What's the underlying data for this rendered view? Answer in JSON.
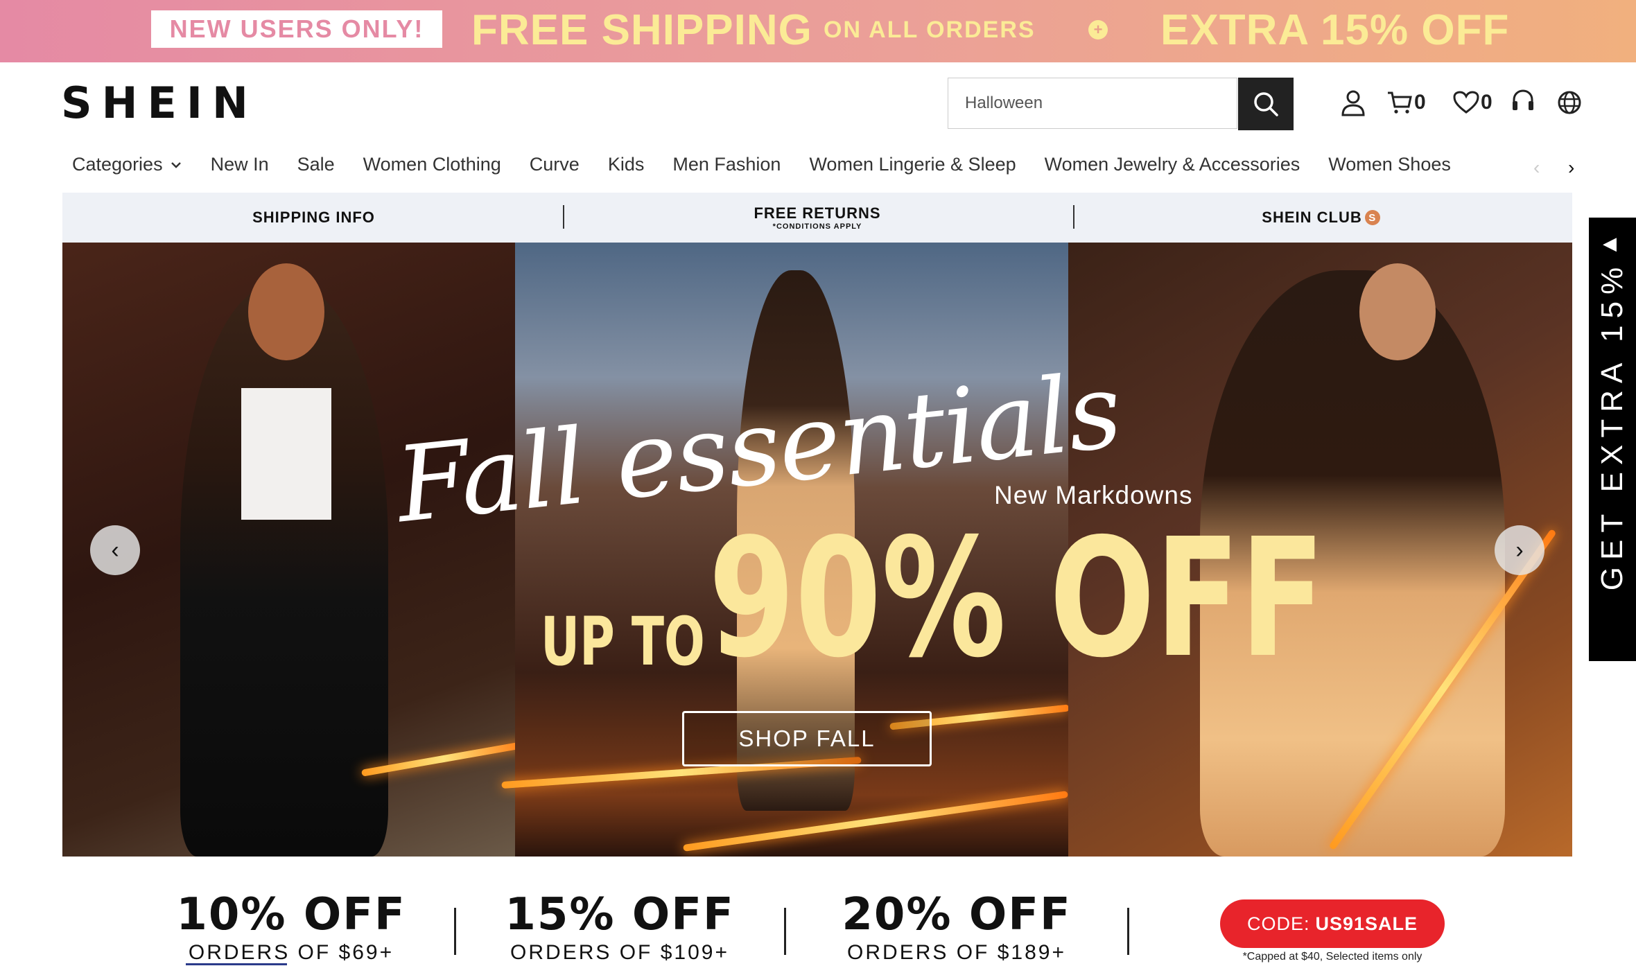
{
  "promo_banner": {
    "badge": "NEW USERS ONLY!",
    "headline": "FREE SHIPPING",
    "headline_sub": "ON ALL ORDERS",
    "headline_2": "EXTRA 15% OFF",
    "colors": {
      "gradient_start": "#e58aa4",
      "gradient_end": "#f1b07e",
      "text": "#fbeb96"
    }
  },
  "header": {
    "logo": "SHEIN",
    "search": {
      "value": "Halloween",
      "icon": "search-icon"
    },
    "icons": [
      {
        "name": "user-icon"
      },
      {
        "name": "cart-icon",
        "count": "0"
      },
      {
        "name": "heart-icon",
        "count": "0"
      },
      {
        "name": "headset-icon"
      },
      {
        "name": "globe-icon"
      }
    ]
  },
  "nav": {
    "items": [
      "Categories",
      "New In",
      "Sale",
      "Women Clothing",
      "Curve",
      "Kids",
      "Men Fashion",
      "Women Lingerie & Sleep",
      "Women Jewelry & Accessories",
      "Women Shoes"
    ]
  },
  "info_bar": {
    "shipping": "SHIPPING INFO",
    "returns": "FREE RETURNS",
    "returns_note": "*CONDITIONS APPLY",
    "club": "SHEIN CLUB",
    "club_badge": "S"
  },
  "hero": {
    "script": "Fall essentials",
    "subtitle": "New Markdowns",
    "up_to": "UP TO",
    "discount": "90% OFF",
    "cta": "SHOP FALL",
    "prev": "‹",
    "next": "›"
  },
  "side_tab": {
    "label": "GET EXTRA 15%"
  },
  "discounts": {
    "tiers": [
      {
        "amount": "10% OFF",
        "condition": "ORDERS OF $69+"
      },
      {
        "amount": "15% OFF",
        "condition": "ORDERS OF $109+"
      },
      {
        "amount": "20% OFF",
        "condition": "ORDERS OF $189+"
      }
    ],
    "code_label": "CODE:",
    "code": "US91SALE",
    "note": "*Capped at $40, Selected items only",
    "accent": "#e8242b"
  }
}
